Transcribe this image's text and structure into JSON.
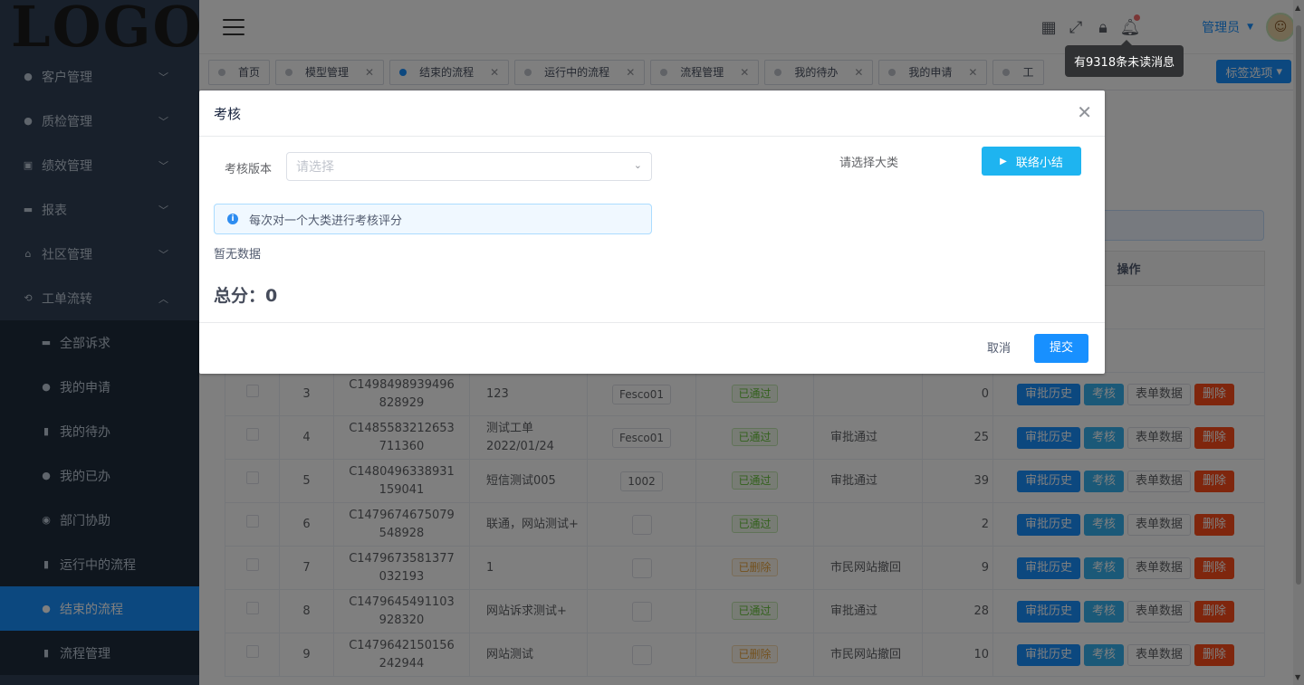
{
  "sidebar": {
    "logo": "LOGO",
    "items": [
      {
        "label": "客户管理",
        "icon": "customer-icon",
        "expanded": false
      },
      {
        "label": "质检管理",
        "icon": "quality-icon",
        "expanded": false
      },
      {
        "label": "绩效管理",
        "icon": "performance-icon",
        "expanded": false
      },
      {
        "label": "报表",
        "icon": "report-icon",
        "expanded": false
      },
      {
        "label": "社区管理",
        "icon": "community-icon",
        "expanded": false
      },
      {
        "label": "工单流转",
        "icon": "workflow-icon",
        "expanded": true
      }
    ],
    "subitems": [
      {
        "label": "全部诉求",
        "icon": "folder-icon"
      },
      {
        "label": "我的申请",
        "icon": "circle-icon"
      },
      {
        "label": "我的待办",
        "icon": "doc-icon"
      },
      {
        "label": "我的已办",
        "icon": "circle-icon"
      },
      {
        "label": "部门协助",
        "icon": "dept-icon"
      },
      {
        "label": "运行中的流程",
        "icon": "doc-icon"
      },
      {
        "label": "结束的流程",
        "icon": "circle-icon",
        "active": true
      },
      {
        "label": "流程管理",
        "icon": "doc-icon"
      }
    ]
  },
  "navbar": {
    "user_name": "管理员",
    "tooltip": "有9318条未读消息",
    "accent": "#1890ff"
  },
  "tags": {
    "items": [
      {
        "label": "首页",
        "closable": false
      },
      {
        "label": "模型管理",
        "closable": true
      },
      {
        "label": "结束的流程",
        "closable": true,
        "active": true
      },
      {
        "label": "运行中的流程",
        "closable": true
      },
      {
        "label": "流程管理",
        "closable": true
      },
      {
        "label": "我的待办",
        "closable": true
      },
      {
        "label": "我的申请",
        "closable": true
      },
      {
        "label": "工",
        "closable": false
      }
    ],
    "options_label": "标签选项"
  },
  "table": {
    "header_actions": "操作",
    "rows": [
      {
        "num": "3",
        "code": "C1498498939496828929",
        "title": "123",
        "tag": "Fesco01",
        "status": "已通过",
        "status_type": "pass",
        "result": "",
        "count": "0"
      },
      {
        "num": "4",
        "code": "C1485583212653711360",
        "title": "测试工单2022/01/24",
        "tag": "Fesco01",
        "status": "已通过",
        "status_type": "pass",
        "result": "审批通过",
        "count": "25"
      },
      {
        "num": "5",
        "code": "C1480496338931159041",
        "title": "短信测试005",
        "tag": "1002",
        "status": "已通过",
        "status_type": "pass",
        "result": "审批通过",
        "count": "39"
      },
      {
        "num": "6",
        "code": "C1479674675079548928",
        "title": "联通，网站测试+",
        "tag": "",
        "status": "已通过",
        "status_type": "pass",
        "result": "",
        "count": "2"
      },
      {
        "num": "7",
        "code": "C1479673581377032193",
        "title": "1",
        "tag": "",
        "status": "已删除",
        "status_type": "del",
        "result": "市民网站撤回",
        "count": "9"
      },
      {
        "num": "8",
        "code": "C1479645491103928320",
        "title": "网站诉求测试+",
        "tag": "",
        "status": "已通过",
        "status_type": "pass",
        "result": "审批通过",
        "count": "28"
      },
      {
        "num": "9",
        "code": "C1479642150156242944",
        "title": "网站测试",
        "tag": "",
        "status": "已删除",
        "status_type": "del",
        "result": "市民网站撤回",
        "count": "10"
      }
    ],
    "btn_history": "审批历史",
    "btn_audit": "考核",
    "btn_data": "表单数据",
    "btn_delete": "删除"
  },
  "dialog": {
    "title": "考核",
    "version_label": "考核版本",
    "version_placeholder": "请选择",
    "choose_category": "请选择大类",
    "summary_button": "联络小结",
    "alert_text": "每次对一个大类进行考核评分",
    "no_data": "暂无数据",
    "total": "总分：0",
    "cancel": "取消",
    "submit": "提交"
  }
}
